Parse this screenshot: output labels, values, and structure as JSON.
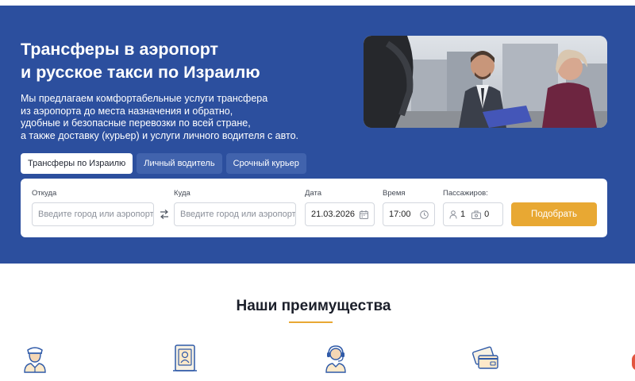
{
  "hero": {
    "title_line1": "Трансферы в аэропорт",
    "title_line2": "и русское такси по Израилю",
    "description_lines": [
      "Мы предлагаем комфортабельные услуги трансфера",
      "из аэропорта до места назначения и обратно,",
      "удобные и безопасные перевозки по всей стране,",
      "а также доставку (курьер) и услуги личного водителя с авто."
    ]
  },
  "tabs": [
    {
      "label": "Трансферы по Израилю",
      "active": true
    },
    {
      "label": "Личный водитель",
      "active": false
    },
    {
      "label": "Срочный курьер",
      "active": false
    }
  ],
  "search": {
    "from_label": "Откуда",
    "from_placeholder": "Введите город или аэропорт",
    "to_label": "Куда",
    "to_placeholder": "Введите город или аэропорт",
    "date_label": "Дата",
    "date_value": "21.03.2026",
    "time_label": "Время",
    "time_value": "17:00",
    "passengers_label": "Пассажиров:",
    "passengers_count": "1",
    "luggage_count": "0",
    "submit_label": "Подобрать"
  },
  "advantages": {
    "title": "Наши преимущества",
    "icons": [
      "driver-icon",
      "document-icon",
      "support-operator-icon",
      "payment-card-icon"
    ]
  },
  "colors": {
    "hero_bg": "#2c4f9e",
    "tab_inactive": "#4163ad",
    "accent": "#e8a833",
    "icon_blue": "#2f5aa8"
  }
}
